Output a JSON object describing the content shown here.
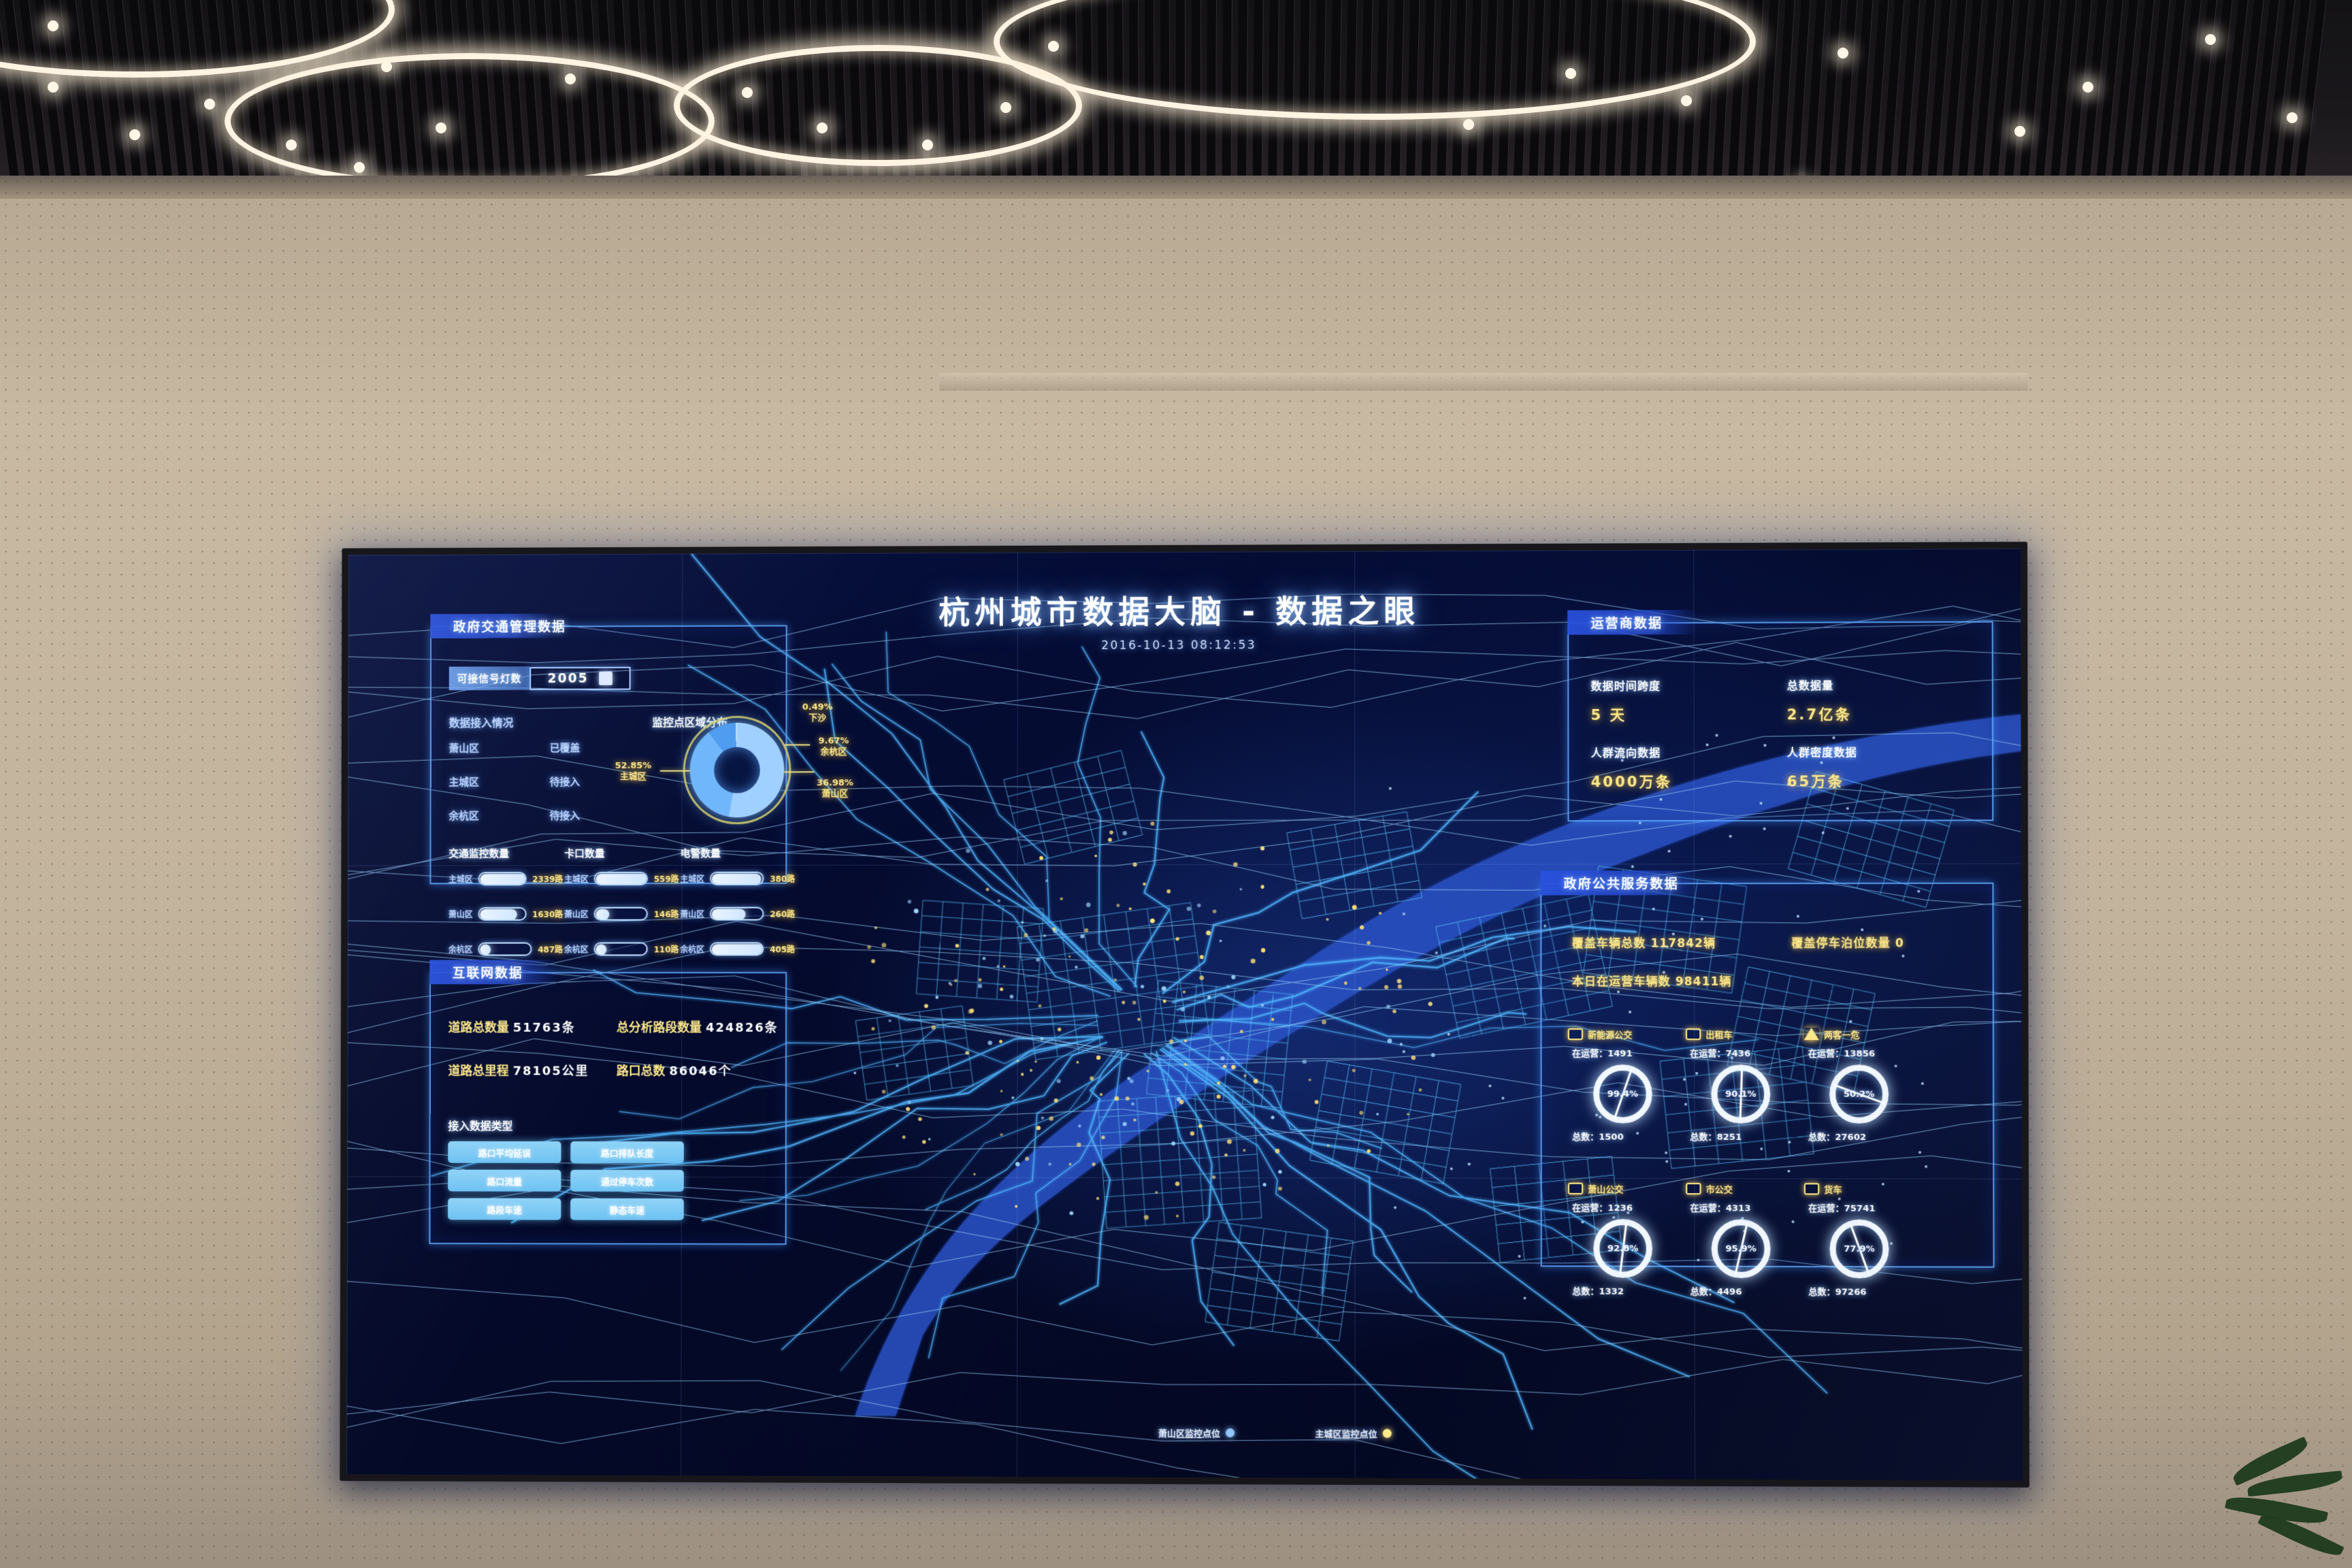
{
  "screen": {
    "title": "杭州城市数据大脑 - 数据之眼",
    "timestamp": "2016-10-13 08:12:53"
  },
  "gov_traffic": {
    "header": "政府交通管理数据",
    "signal": {
      "label": "可接信号灯数",
      "value": "2005"
    },
    "access": {
      "title": "数据接入情况",
      "rows": [
        {
          "district": "萧山区",
          "status": "已覆盖"
        },
        {
          "district": "主城区",
          "status": "待接入"
        },
        {
          "district": "余杭区",
          "status": "待接入"
        }
      ]
    },
    "donut": {
      "title": "监控点区域分布",
      "labels": [
        {
          "pct": "0.49%",
          "name": "下沙"
        },
        {
          "pct": "9.67%",
          "name": "余杭区"
        },
        {
          "pct": "36.98%",
          "name": "萧山区"
        },
        {
          "pct": "52.85%",
          "name": "主城区"
        }
      ]
    },
    "bars": [
      {
        "title": "交通监控数量",
        "rows": [
          {
            "name": "主城区",
            "value": "2339路",
            "pct": 100
          },
          {
            "name": "萧山区",
            "value": "1630路",
            "pct": 70
          },
          {
            "name": "余杭区",
            "value": "487路",
            "pct": 21
          }
        ]
      },
      {
        "title": "卡口数量",
        "rows": [
          {
            "name": "主城区",
            "value": "559路",
            "pct": 100
          },
          {
            "name": "萧山区",
            "value": "146路",
            "pct": 26
          },
          {
            "name": "余杭区",
            "value": "110路",
            "pct": 20
          }
        ]
      },
      {
        "title": "电警数量",
        "rows": [
          {
            "name": "主城区",
            "value": "380路",
            "pct": 94
          },
          {
            "name": "萧山区",
            "value": "260路",
            "pct": 64
          },
          {
            "name": "余杭区",
            "value": "405路",
            "pct": 100
          }
        ]
      }
    ]
  },
  "internet": {
    "header": "互联网数据",
    "stats": [
      {
        "key": "道路总数量",
        "value": "51763条"
      },
      {
        "key": "总分析路段数量",
        "value": "424826条"
      },
      {
        "key": "道路总里程",
        "value": "78105公里"
      },
      {
        "key": "路口总数",
        "value": "86046个"
      }
    ],
    "types_title": "接入数据类型",
    "types": [
      "路口平均延误",
      "路口排队长度",
      "路口流量",
      "通过停车次数",
      "路段车速",
      "静态车速"
    ]
  },
  "operator": {
    "header": "运营商数据",
    "metrics": [
      {
        "key": "数据时间跨度",
        "value": "5 天"
      },
      {
        "key": "总数据量",
        "value": "2.7亿条"
      },
      {
        "key": "人群流向数据",
        "value": "4000万条"
      },
      {
        "key": "人群密度数据",
        "value": "65万条"
      }
    ]
  },
  "public_service": {
    "header": "政府公共服务数据",
    "stats": [
      "覆盖车辆总数 117842辆",
      "覆盖停车泊位数量 0",
      "本日在运营车辆数 98411辆"
    ],
    "gauges": [
      {
        "icon": "bus-icon",
        "name": "新能源公交",
        "operating_label": "在运营：1491",
        "pct": "99.4%",
        "pct_num": 99.4,
        "total_label": "总数：1500"
      },
      {
        "icon": "taxi-icon",
        "name": "出租车",
        "operating_label": "在运营：7436",
        "pct": "90.1%",
        "pct_num": 90.1,
        "total_label": "总数：8251"
      },
      {
        "icon": "warn-icon",
        "name": "两客一危",
        "operating_label": "在运营：13856",
        "pct": "50.2%",
        "pct_num": 50.2,
        "total_label": "总数：27602"
      },
      {
        "icon": "bus-icon",
        "name": "萧山公交",
        "operating_label": "在运营：1236",
        "pct": "92.8%",
        "pct_num": 92.8,
        "total_label": "总数：1332"
      },
      {
        "icon": "bus-icon",
        "name": "市公交",
        "operating_label": "在运营：4313",
        "pct": "95.9%",
        "pct_num": 95.9,
        "total_label": "总数：4496"
      },
      {
        "icon": "truck-icon",
        "name": "货车",
        "operating_label": "在运营：75741",
        "pct": "77.9%",
        "pct_num": 77.9,
        "total_label": "总数：97266"
      }
    ]
  },
  "legend": [
    {
      "label": "萧山区监控点位",
      "color": "#8fc6ff"
    },
    {
      "label": "主城区监控点位",
      "color": "#ffe98a"
    }
  ],
  "colors": {
    "accent_blue": "#2d5cff",
    "glow_blue": "#7fb8ff",
    "value_yellow": "#ffe98a",
    "panel_border": "#60aaff"
  }
}
